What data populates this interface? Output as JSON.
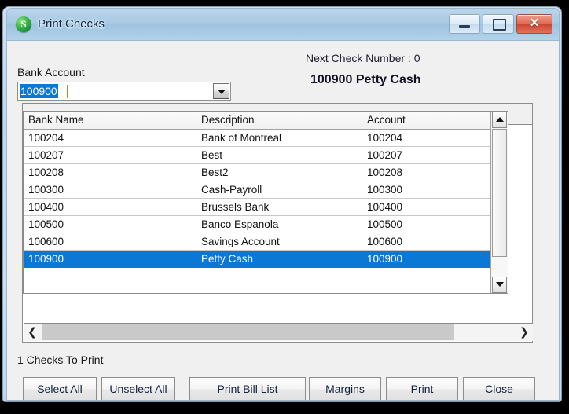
{
  "window": {
    "title": "Print Checks",
    "icon": "sage-s-icon",
    "controls": {
      "minimize": "minimize-icon",
      "maximize": "maximize-icon",
      "close": "✕"
    }
  },
  "form": {
    "bank_account_label": "Bank Account",
    "bank_account_value": "100900",
    "dropdown_icon": "chevron-down-icon",
    "next_check_number": "Next Check Number : 0",
    "account_title": "100900 Petty Cash",
    "checks_to_print": "1 Checks To Print"
  },
  "grid": {
    "columns": [
      "Bank Name",
      "Description",
      "Account"
    ],
    "rows": [
      {
        "bank_name": "100204",
        "description": "Bank of Montreal",
        "account": "100204",
        "selected": false
      },
      {
        "bank_name": "100207",
        "description": "Best",
        "account": "100207",
        "selected": false
      },
      {
        "bank_name": "100208",
        "description": "Best2",
        "account": "100208",
        "selected": false
      },
      {
        "bank_name": "100300",
        "description": "Cash-Payroll",
        "account": "100300",
        "selected": false
      },
      {
        "bank_name": "100400",
        "description": "Brussels Bank",
        "account": "100400",
        "selected": false
      },
      {
        "bank_name": "100500",
        "description": "Banco Espanola",
        "account": "100500",
        "selected": false
      },
      {
        "bank_name": "100600",
        "description": "Savings Account",
        "account": "100600",
        "selected": false
      },
      {
        "bank_name": "100900",
        "description": "Petty Cash",
        "account": "100900",
        "selected": true
      }
    ],
    "scroll_up_icon": "triangle-up-icon",
    "scroll_down_icon": "triangle-down-icon",
    "scroll_left_icon": "❮",
    "scroll_right_icon": "❯"
  },
  "buttons": [
    {
      "key": "select_all",
      "label": "Select All",
      "mnemonic": "S"
    },
    {
      "key": "unselect_all",
      "label": "Unselect All",
      "mnemonic": "U"
    },
    {
      "key": "print_bill",
      "label": "Print Bill List",
      "mnemonic": "P"
    },
    {
      "key": "margins",
      "label": "Margins",
      "mnemonic": "M"
    },
    {
      "key": "print",
      "label": "Print",
      "mnemonic": "P"
    },
    {
      "key": "close",
      "label": "Close",
      "mnemonic": "C"
    }
  ],
  "colors": {
    "selection_blue": "#0a78d4",
    "window_background": "#f0f0f0",
    "titlebar_blue": "#a9cbe4",
    "close_red": "#c94631"
  }
}
